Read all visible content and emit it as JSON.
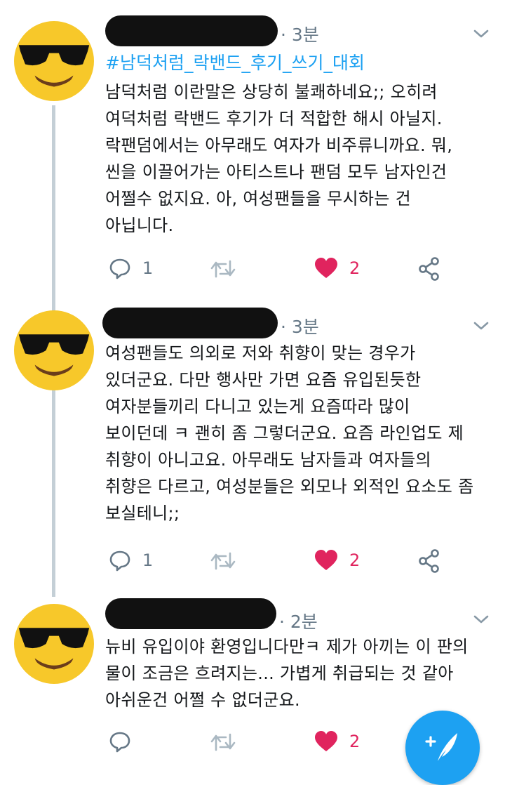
{
  "tweets": [
    {
      "time": "· 3분",
      "hashtag": "#남덕처럼_락밴드_후기_쓰기_대회",
      "lines": [
        "남덕처럼 이란말은 상당히 불쾌하네요;; 오히려",
        "여덕처럼 락밴드 후기가 더 적합한 해시 아닐지.",
        "락팬덤에서는 아무래도 여자가 비주류니까요. 뭐,",
        "씬을 이끌어가는 아티스트나 팬덤 모두 남자인건",
        "어쩔수 없지요. 아, 여성팬들을 무시하는 건",
        "아닙니다."
      ],
      "reply_count": "1",
      "like_count": "2"
    },
    {
      "time": "· 3분",
      "lines": [
        "여성팬들도 의외로 저와 취향이 맞는 경우가",
        "있더군요. 다만 행사만 가면 요즘 유입된듯한",
        "여자분들끼리 다니고 있는게 요즘따라 많이",
        "보이던데 ㅋ 괜히 좀 그렇더군요. 요즘 라인업도 제",
        "취향이 아니고요. 아무래도 남자들과 여자들의",
        "취향은 다르고, 여성분들은 외모나 외적인 요소도 좀",
        "보실테니;;"
      ],
      "reply_count": "1",
      "like_count": "2"
    },
    {
      "time": "· 2분",
      "lines": [
        "뉴비 유입이야 환영입니다만ㅋ 제가 아끼는 이 판의",
        "물이 조금은 흐려지는... 가볍게 취급되는 것 같아",
        "아쉬운건 어쩔 수 없더군요."
      ],
      "reply_count": "",
      "like_count": "2"
    }
  ],
  "icons": {
    "reply": "reply-icon",
    "retweet": "retweet-icon",
    "like": "heart-icon",
    "share": "share-icon",
    "compose": "compose-tweet-icon",
    "menu": "chevron-down-icon",
    "avatar": "sunglasses-emoji-avatar"
  },
  "colors": {
    "accent": "#1da1f2",
    "like": "#e0245e",
    "muted": "#657786",
    "avatar_face": "#f7c82a",
    "thread_line": "#c4cfd6"
  }
}
